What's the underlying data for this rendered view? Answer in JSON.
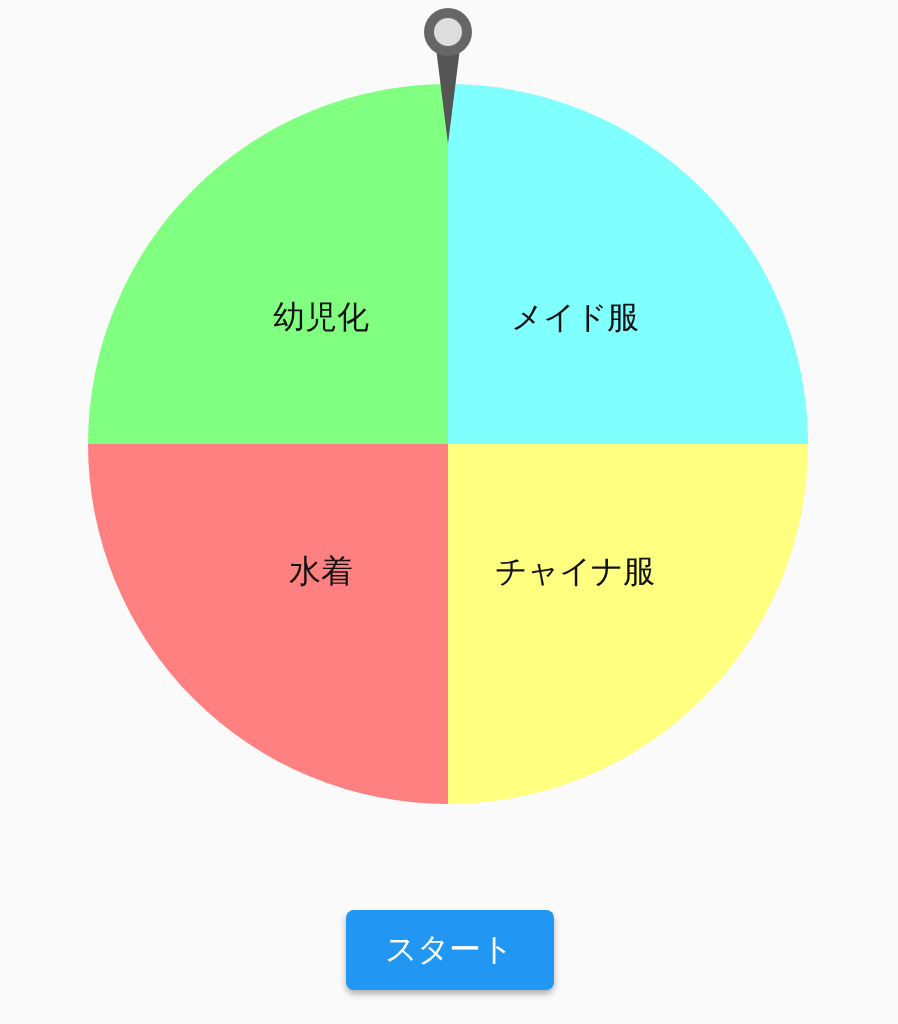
{
  "roulette": {
    "segments": [
      {
        "label": "幼児化",
        "color": "#80ff80"
      },
      {
        "label": "メイド服",
        "color": "#80ffff"
      },
      {
        "label": "水着",
        "color": "#ff8080"
      },
      {
        "label": "チャイナ服",
        "color": "#ffff80"
      }
    ]
  },
  "start_button": {
    "label": "スタート"
  }
}
